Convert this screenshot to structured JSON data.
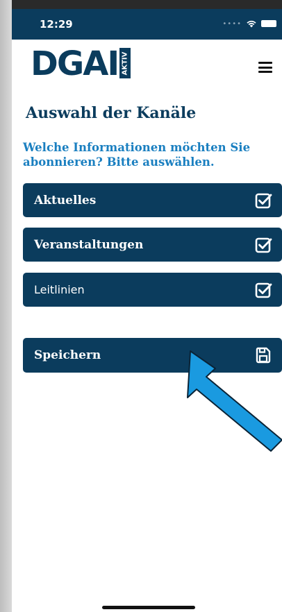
{
  "statusbar": {
    "time": "12:29",
    "signal_icon": "signal-dots-icon",
    "wifi_icon": "wifi-icon",
    "battery_icon": "battery-icon"
  },
  "header": {
    "logo_text": "DGAI",
    "logo_badge": "AKTIV",
    "menu_icon": "hamburger-menu-icon"
  },
  "page": {
    "title": "Auswahl der Kanäle",
    "question": "Welche Informationen möchten Sie abonnieren? Bitte auswählen."
  },
  "channels": [
    {
      "label": "Aktuelles",
      "checked": true,
      "icon": "checkbox-checked-icon"
    },
    {
      "label": "Veranstaltungen",
      "checked": true,
      "icon": "checkbox-checked-icon"
    },
    {
      "label": "Leitlinien",
      "checked": true,
      "icon": "checkbox-checked-icon"
    }
  ],
  "save": {
    "label": "Speichern",
    "icon": "floppy-disk-save-icon"
  },
  "annotation": {
    "icon": "blue-pointer-arrow",
    "color": "#1a9ae0"
  },
  "colors": {
    "primary": "#0b3c5d",
    "accent_text": "#1a7fc0",
    "background": "#ffffff"
  }
}
